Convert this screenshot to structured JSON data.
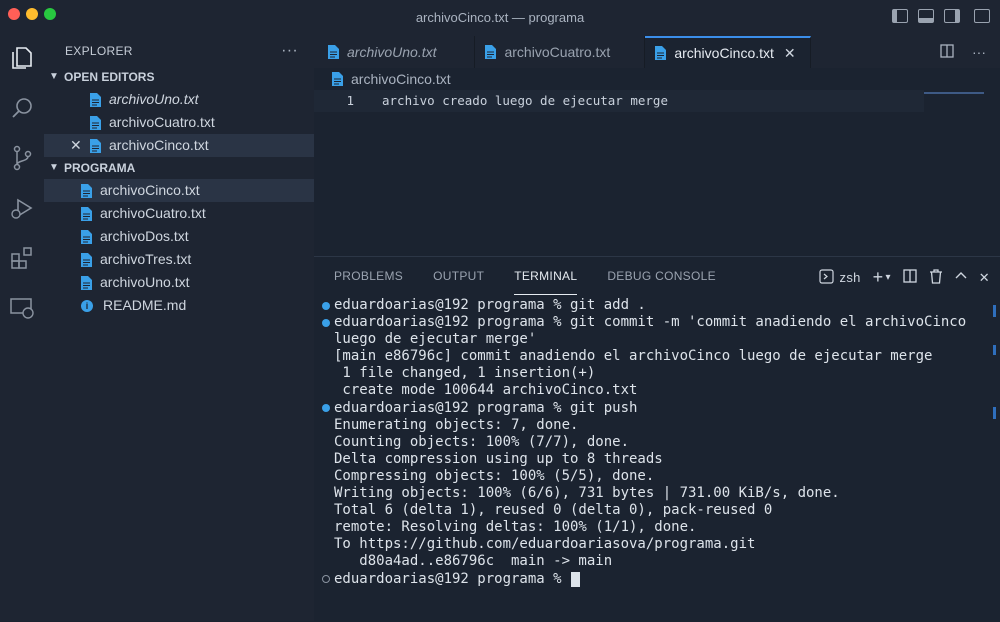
{
  "window": {
    "title": "archivoCinco.txt — programa"
  },
  "activity_bar": [
    "explorer-icon",
    "search-icon",
    "source-control-icon",
    "run-debug-icon",
    "extensions-icon",
    "remote-explorer-icon"
  ],
  "sidebar": {
    "header": "EXPLORER",
    "more": "···",
    "open_editors_title": "OPEN EDITORS",
    "open_editors": [
      {
        "label": "archivoUno.txt"
      },
      {
        "label": "archivoCuatro.txt"
      },
      {
        "label": "archivoCinco.txt",
        "close": "✕"
      }
    ],
    "folder_title": "PROGRAMA",
    "files": [
      {
        "label": "archivoCinco.txt"
      },
      {
        "label": "archivoCuatro.txt"
      },
      {
        "label": "archivoDos.txt"
      },
      {
        "label": "archivoTres.txt"
      },
      {
        "label": "archivoUno.txt"
      },
      {
        "label": "README.md"
      }
    ]
  },
  "editor": {
    "tabs": [
      {
        "label": "archivoUno.txt"
      },
      {
        "label": "archivoCuatro.txt"
      },
      {
        "label": "archivoCinco.txt",
        "close": "✕"
      }
    ],
    "breadcrumb": "archivoCinco.txt",
    "lines": [
      {
        "num": "1",
        "text": "archivo creado luego de ejecutar merge"
      }
    ]
  },
  "panel": {
    "tabs": [
      "PROBLEMS",
      "OUTPUT",
      "TERMINAL",
      "DEBUG CONSOLE"
    ],
    "active_tab": "TERMINAL",
    "shell_label": "zsh",
    "terminal_lines": [
      {
        "marker": "filled",
        "text": "eduardoarias@192 programa % git add ."
      },
      {
        "marker": "filled",
        "text": "eduardoarias@192 programa % git commit -m 'commit anadiendo el archivoCinco"
      },
      {
        "marker": "none",
        "text": "luego de ejecutar merge'"
      },
      {
        "marker": "none",
        "text": "[main e86796c] commit anadiendo el archivoCinco luego de ejecutar merge"
      },
      {
        "marker": "none",
        "text": " 1 file changed, 1 insertion(+)"
      },
      {
        "marker": "none",
        "text": " create mode 100644 archivoCinco.txt"
      },
      {
        "marker": "filled",
        "text": "eduardoarias@192 programa % git push"
      },
      {
        "marker": "none",
        "text": "Enumerating objects: 7, done."
      },
      {
        "marker": "none",
        "text": "Counting objects: 100% (7/7), done."
      },
      {
        "marker": "none",
        "text": "Delta compression using up to 8 threads"
      },
      {
        "marker": "none",
        "text": "Compressing objects: 100% (5/5), done."
      },
      {
        "marker": "none",
        "text": "Writing objects: 100% (6/6), 731 bytes | 731.00 KiB/s, done."
      },
      {
        "marker": "none",
        "text": "Total 6 (delta 1), reused 0 (delta 0), pack-reused 0"
      },
      {
        "marker": "none",
        "text": "remote: Resolving deltas: 100% (1/1), done."
      },
      {
        "marker": "none",
        "text": "To https://github.com/eduardoariasova/programa.git"
      },
      {
        "marker": "none",
        "text": "   d80a4ad..e86796c  main -> main"
      },
      {
        "marker": "hollow",
        "text": "eduardoarias@192 programa % "
      }
    ]
  },
  "colors": {
    "accent": "#3b8eea",
    "file_icon": "#3aa0e8",
    "background": "#1b2330",
    "sidebar": "#1e2532"
  }
}
